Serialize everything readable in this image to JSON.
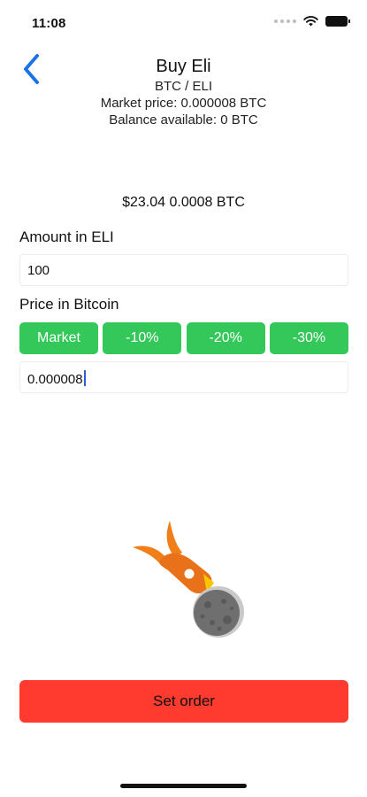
{
  "status_bar": {
    "time": "11:08",
    "icons": [
      "signal-dots-icon",
      "wifi-icon",
      "battery-icon"
    ]
  },
  "nav": {
    "back_icon": "chevron-left-icon",
    "accent_color": "#1a73e8"
  },
  "header": {
    "title": "Buy Eli",
    "pair": "BTC / ELI",
    "market_price": "Market price: 0.000008 BTC",
    "balance": "Balance available: 0 BTC"
  },
  "summary": {
    "text": "$23.04 0.0008 BTC"
  },
  "amount": {
    "label": "Amount in ELI",
    "value": "100"
  },
  "price": {
    "label": "Price in Bitcoin",
    "value": "0.000008",
    "buttons": [
      {
        "label": "Market"
      },
      {
        "label": "-10%"
      },
      {
        "label": "-20%"
      },
      {
        "label": "-30%"
      }
    ],
    "button_color": "#34c759"
  },
  "illustration": {
    "icon": "rocket-moon-icon"
  },
  "action": {
    "set_order_label": "Set order",
    "color": "#ff3b30"
  }
}
